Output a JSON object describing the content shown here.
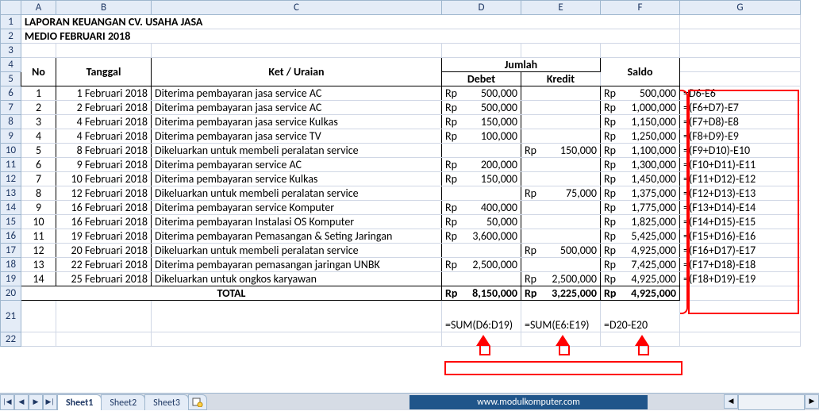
{
  "title": "LAPORAN KEUANGAN CV. USAHA JASA",
  "subtitle": "MEDIO FEBRUARI 2018",
  "headers": {
    "no": "No",
    "tanggal": "Tanggal",
    "ket": "Ket / Uraian",
    "jumlah": "Jumlah",
    "debet": "Debet",
    "kredit": "Kredit",
    "saldo": "Saldo",
    "total": "TOTAL",
    "rp": "Rp"
  },
  "rows": [
    {
      "no": "1",
      "tanggal": "1 Februari 2018",
      "ket": "Diterima pembayaran jasa service AC",
      "debet": "500,000",
      "kredit": "",
      "saldo": "500,000"
    },
    {
      "no": "2",
      "tanggal": "2 Februari 2018",
      "ket": "Diterima pembayaran jasa service AC",
      "debet": "500,000",
      "kredit": "",
      "saldo": "1,000,000"
    },
    {
      "no": "3",
      "tanggal": "4 Februari 2018",
      "ket": "Diterima pembayaran jasa service Kulkas",
      "debet": "150,000",
      "kredit": "",
      "saldo": "1,150,000"
    },
    {
      "no": "4",
      "tanggal": "4 Februari 2018",
      "ket": "Diterima pembayaran jasa service TV",
      "debet": "100,000",
      "kredit": "",
      "saldo": "1,250,000"
    },
    {
      "no": "5",
      "tanggal": "8 Februari 2018",
      "ket": "Dikeluarkan untuk membeli peralatan service",
      "debet": "",
      "kredit": "150,000",
      "saldo": "1,100,000"
    },
    {
      "no": "6",
      "tanggal": "9 Februari 2018",
      "ket": "Diterima pembayaran service AC",
      "debet": "200,000",
      "kredit": "",
      "saldo": "1,300,000"
    },
    {
      "no": "7",
      "tanggal": "10 Februari 2018",
      "ket": "Diterima pembayaran service Kulkas",
      "debet": "150,000",
      "kredit": "",
      "saldo": "1,450,000"
    },
    {
      "no": "8",
      "tanggal": "12 Februari 2018",
      "ket": "Dikeluarkan untuk membeli peralatan service",
      "debet": "",
      "kredit": "75,000",
      "saldo": "1,375,000"
    },
    {
      "no": "9",
      "tanggal": "16 Februari 2018",
      "ket": "Diterima pembayaran service Komputer",
      "debet": "400,000",
      "kredit": "",
      "saldo": "1,775,000"
    },
    {
      "no": "10",
      "tanggal": "16 Februari 2018",
      "ket": "Diterima pembayaran Instalasi OS Komputer",
      "debet": "50,000",
      "kredit": "",
      "saldo": "1,825,000"
    },
    {
      "no": "11",
      "tanggal": "19 Februari 2018",
      "ket": "Diterima pembayaran Pemasangan & Seting Jaringan",
      "debet": "3,600,000",
      "kredit": "",
      "saldo": "5,425,000"
    },
    {
      "no": "12",
      "tanggal": "20 Februari 2018",
      "ket": "Dikeluarkan untuk membeli peralatan service",
      "debet": "",
      "kredit": "500,000",
      "saldo": "4,925,000"
    },
    {
      "no": "13",
      "tanggal": "22 Februari 2018",
      "ket": "Diterima pembayaran pemasangan jaringan UNBK",
      "debet": "2,500,000",
      "kredit": "",
      "saldo": "7,425,000"
    },
    {
      "no": "14",
      "tanggal": "25 Februari 2018",
      "ket": "Dikeluarkan untuk ongkos karyawan",
      "debet": "",
      "kredit": "2,500,000",
      "saldo": "4,925,000"
    }
  ],
  "totals": {
    "debet": "8,150,000",
    "kredit": "3,225,000",
    "saldo": "4,925,000"
  },
  "formulas_g": [
    "=D6-E6",
    "=(F6+D7)-E7",
    "=(F7+D8)-E8",
    "=(F8+D9)-E9",
    "=(F9+D10)-E10",
    "=(F10+D11)-E11",
    "=(F11+D12)-E12",
    "=(F12+D13)-E13",
    "=(F13+D14)-E14",
    "=(F14+D15)-E15",
    "=(F15+D16)-E16",
    "=(F16+D17)-E17",
    "=(F17+D18)-E18",
    "=(F18+D19)-E19"
  ],
  "formulas_bot": {
    "d": "=SUM(D6:D19)",
    "e": "=SUM(E6:E19)",
    "f": "=D20-E20"
  },
  "row_labels": [
    "1",
    "2",
    "3",
    "4",
    "5",
    "6",
    "7",
    "8",
    "9",
    "10",
    "11",
    "12",
    "13",
    "14",
    "15",
    "16",
    "17",
    "18",
    "19",
    "20",
    "21",
    "22"
  ],
  "col_labels": [
    "A",
    "B",
    "C",
    "D",
    "E",
    "F",
    "G"
  ],
  "tabs": [
    "Sheet1",
    "Sheet2",
    "Sheet3"
  ],
  "credit": "www.modulkomputer.com",
  "nav": {
    "first": "|◀",
    "prev": "◀",
    "next": "▶",
    "last": "▶|"
  }
}
